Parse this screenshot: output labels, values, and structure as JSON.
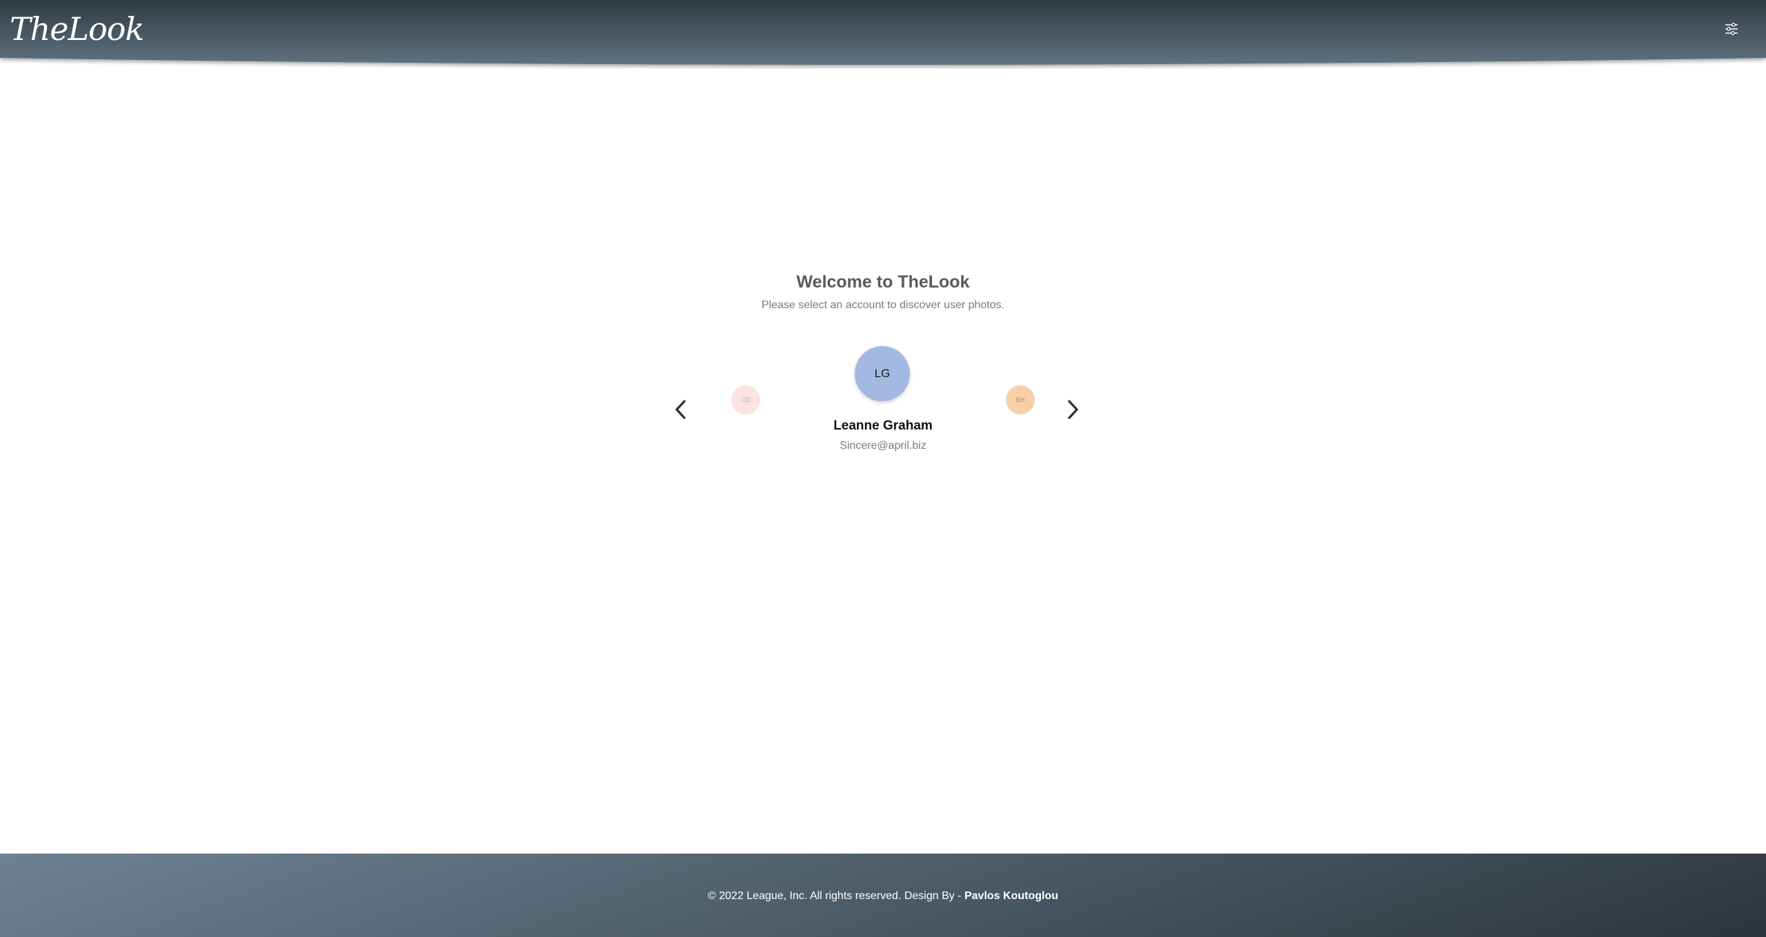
{
  "header": {
    "logo": "TheLook",
    "settings_icon": "sliders-icon"
  },
  "welcome": {
    "title": "Welcome to TheLook",
    "subtitle": "Please select an account to discover user photos."
  },
  "carousel": {
    "prev_icon": "chevron-left-icon",
    "next_icon": "chevron-right-icon",
    "left_avatar": "CD",
    "current_avatar": "LG",
    "right_avatar": "EH",
    "current_user": {
      "name": "Leanne Graham",
      "email": "Sincere@april.biz"
    }
  },
  "footer": {
    "copyright": "© 2022 League, Inc. All rights reserved. Design By - ",
    "author": "Pavlos Koutoglou"
  },
  "colors": {
    "header_dark": "#303b43",
    "header_light": "#5f7280",
    "avatar_main": "#a3b9e2",
    "avatar_left": "#fbe4e2",
    "avatar_right": "#f9cfa9"
  }
}
